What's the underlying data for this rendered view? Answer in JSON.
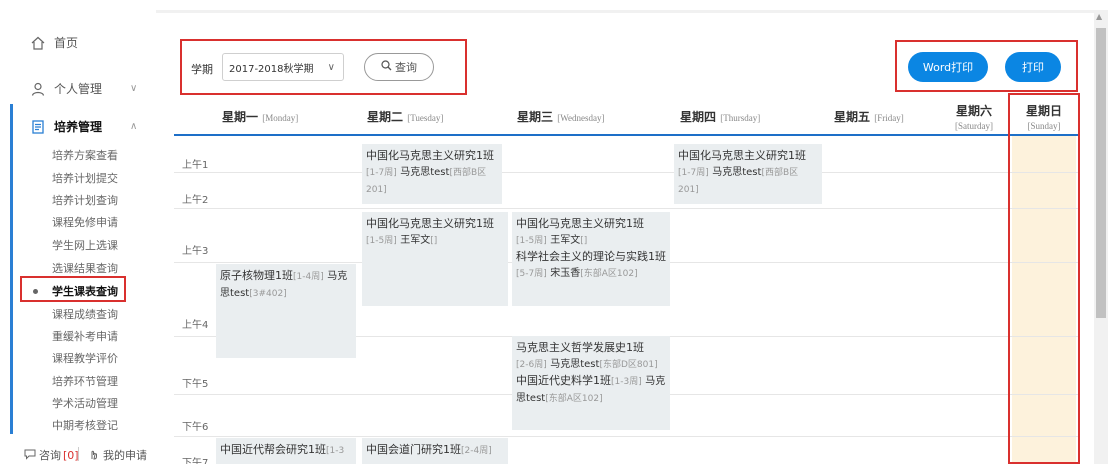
{
  "sidebar": {
    "home": "首页",
    "personal": "个人管理",
    "training": "培养管理",
    "sub_items": [
      "培养方案查看",
      "培养计划提交",
      "培养计划查询",
      "课程免修申请",
      "学生网上选课",
      "选课结果查询",
      "学生课表查询",
      "课程成绩查询",
      "重缓补考申请",
      "课程教学评价",
      "培养环节管理",
      "学术活动管理",
      "中期考核登记"
    ],
    "active_sub": "学生课表查询",
    "consult_label": "咨询",
    "consult_count": "[0]",
    "my_apply": "我的申请"
  },
  "toolbar": {
    "term_label": "学期",
    "term_value": "2017-2018秋学期",
    "search_label": "查询",
    "word_print_label": "Word打印",
    "print_label": "打印"
  },
  "days": [
    {
      "cn": "星期一",
      "en": "[Monday]"
    },
    {
      "cn": "星期二",
      "en": "[Tuesday]"
    },
    {
      "cn": "星期三",
      "en": "[Wednesday]"
    },
    {
      "cn": "星期四",
      "en": "[Thursday]"
    },
    {
      "cn": "星期五",
      "en": "[Friday]"
    },
    {
      "cn": "星期六",
      "en": "[Saturday]"
    },
    {
      "cn": "星期日",
      "en": "[Sunday]"
    }
  ],
  "periods": [
    "上午1",
    "上午2",
    "上午3",
    "上午4",
    "下午5",
    "下午6",
    "下午7"
  ],
  "courses": {
    "tue1": {
      "name": "中国化马克思主义研究1班",
      "weeks": "[1-7周]",
      "teacher": "马克思test",
      "room": "[西部B区201]"
    },
    "thu1": {
      "name": "中国化马克思主义研究1班",
      "weeks": "[1-7周]",
      "teacher": "马克思test",
      "room": "[西部B区201]"
    },
    "tue3": {
      "name": "中国化马克思主义研究1班",
      "weeks": "[1-5周]",
      "teacher": "王军文",
      "room": "[]"
    },
    "wed3a": {
      "name": "中国化马克思主义研究1班",
      "weeks": "[1-5周]",
      "teacher": "王军文",
      "room": "[]"
    },
    "wed3b_name": "科学社会主义的理论与实践1班",
    "wed3b_weeks": "[5-7周]",
    "wed3b_teacher": "宋玉香",
    "wed3b_room": "[东部A区102]",
    "mon4": {
      "name": "原子核物理1班",
      "weeks": "[1-4周]",
      "teacher": "马克思test",
      "room": "[3#402]"
    },
    "wed5a": {
      "name": "马克思主义哲学发展史1班",
      "weeks": "[2-6周]",
      "teacher": "马克思test",
      "room": "[东部D区801]"
    },
    "wed5b": {
      "name": "中国近代史料学1班",
      "weeks": "[1-3周]",
      "teacher": "马克思test",
      "room": "[东部A区102]"
    },
    "mon7": {
      "name": "中国近代帮会研究1班",
      "weeks": "[1-3"
    },
    "tue7": {
      "name": "中国会道门研究1班",
      "weeks": "[2-4周]"
    }
  }
}
